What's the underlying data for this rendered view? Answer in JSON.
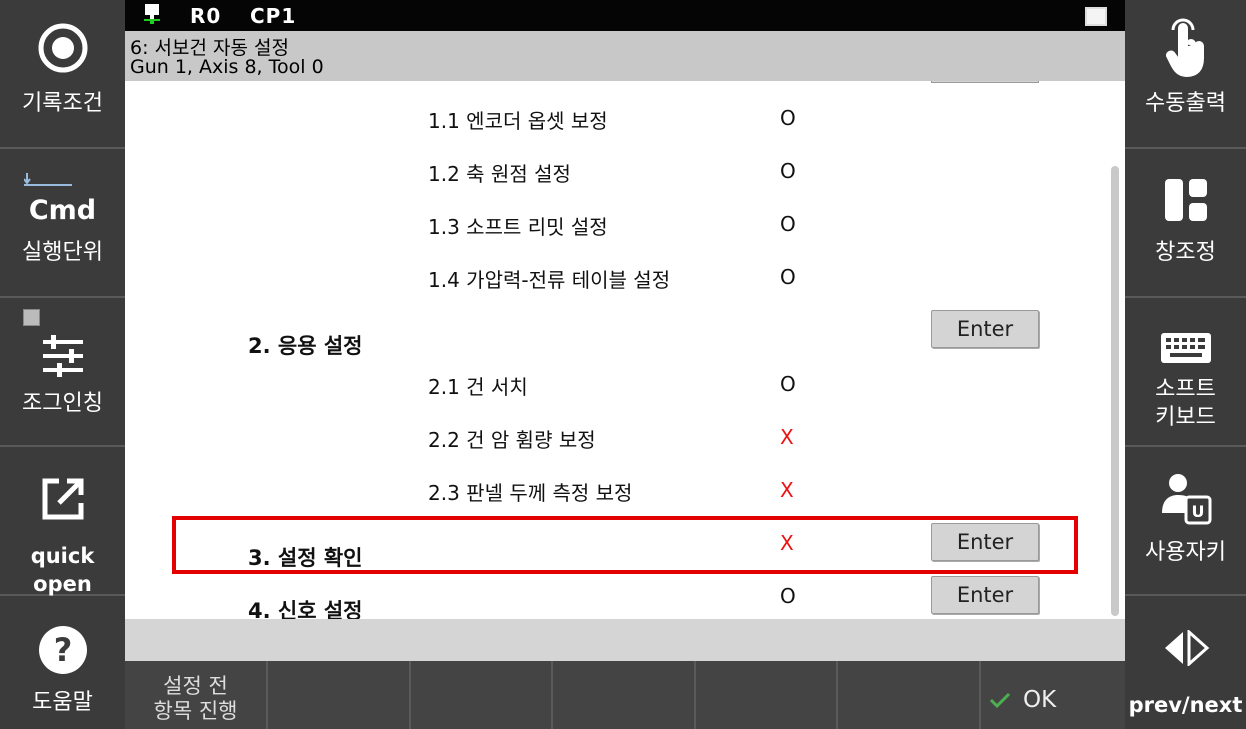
{
  "status": {
    "robot": "R0",
    "program": "CP1"
  },
  "title": {
    "line1": "6: 서보건 자동 설정",
    "line2": "Gun 1, Axis 8, Tool 0"
  },
  "left_menu": [
    {
      "label": "기록조건",
      "icon": "record-circle-icon"
    },
    {
      "label": "실행단위",
      "icon": "cmd-icon",
      "cmd_text": "Cmd"
    },
    {
      "label": "조그인칭",
      "icon": "sliders-icon"
    },
    {
      "label": "quick open",
      "icon": "external-link-icon"
    },
    {
      "label": "도움말",
      "icon": "help-icon"
    }
  ],
  "right_menu": [
    {
      "label": "수동출력",
      "icon": "hand-pointer-icon"
    },
    {
      "label": "창조정",
      "icon": "window-layout-icon"
    },
    {
      "label": "소프트\n키보드",
      "label_line1": "소프트",
      "label_line2": "키보드",
      "icon": "keyboard-icon"
    },
    {
      "label": "사용자키",
      "icon": "user-key-icon"
    },
    {
      "label": "prev/next",
      "icon": "prev-next-icon"
    }
  ],
  "rows": [
    {
      "text": "1.1 엔코더 옵셋 보정",
      "status": "O"
    },
    {
      "text": "1.2 축 원점 설정",
      "status": "O"
    },
    {
      "text": "1.3 소프트 리밋 설정",
      "status": "O"
    },
    {
      "text": "1.4 가압력-전류 테이블 설정",
      "status": "O"
    },
    {
      "text": "2. 응용 설정",
      "enter": "Enter"
    },
    {
      "text": "2.1 건 서치",
      "status": "O"
    },
    {
      "text": "2.2 건 암 휨량 보정",
      "status": "X"
    },
    {
      "text": "2.3 판넬 두께 측정 보정",
      "status": "X"
    },
    {
      "text": "3. 설정 확인",
      "status": "X",
      "enter": "Enter"
    },
    {
      "text": "4. 신호 설정",
      "status": "O",
      "enter": "Enter"
    }
  ],
  "bottom": {
    "first_line1": "설정 전",
    "first_line2": "항목 진행",
    "ok": "OK"
  },
  "colors": {
    "highlight": "#e30000",
    "x_mark": "#ee1111",
    "panel": "#3b3b3b"
  }
}
